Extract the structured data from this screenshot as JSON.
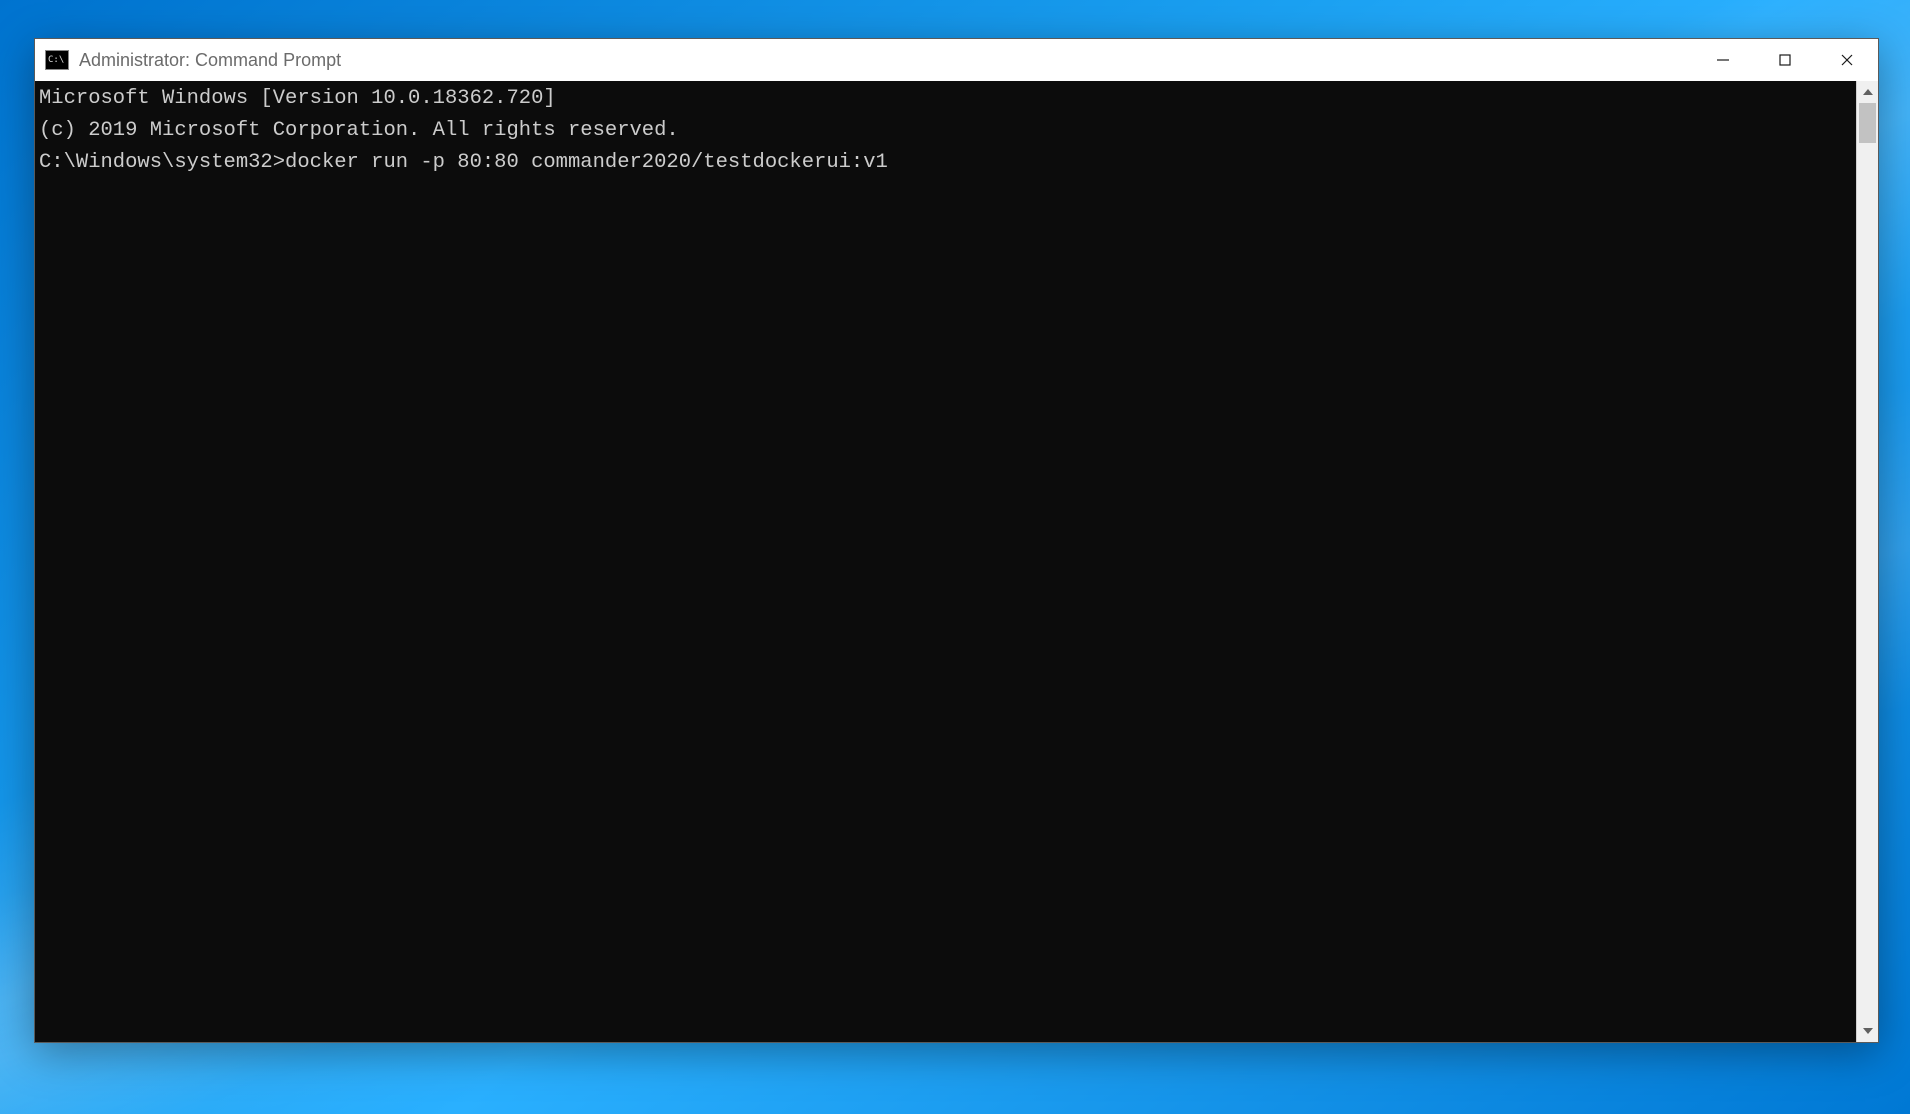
{
  "window": {
    "title": "Administrator: Command Prompt",
    "icon_label": "C:\\"
  },
  "terminal": {
    "lines": [
      "Microsoft Windows [Version 10.0.18362.720]",
      "(c) 2019 Microsoft Corporation. All rights reserved.",
      "",
      "C:\\Windows\\system32>docker run -p 80:80 commander2020/testdockerui:v1"
    ]
  }
}
